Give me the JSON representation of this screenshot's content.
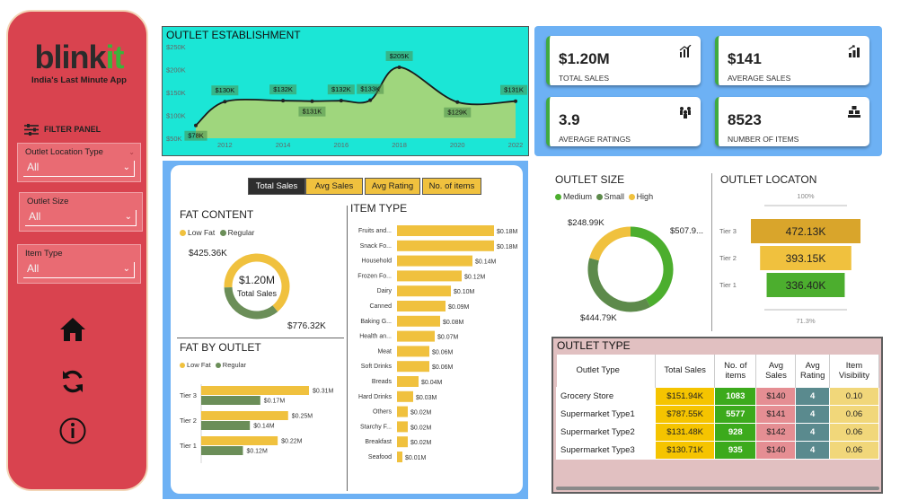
{
  "sidebar": {
    "logo_a": "blink",
    "logo_b": "it",
    "tagline": "India's Last Minute App",
    "filter_panel": "FILTER PANEL",
    "slicers": [
      {
        "label": "Outlet Location Type",
        "value": "All"
      },
      {
        "label": "Outlet Size",
        "value": "All"
      },
      {
        "label": "Item Type",
        "value": "All"
      }
    ],
    "icons": [
      "home-icon",
      "refresh-icon",
      "info-icon"
    ]
  },
  "establishment": {
    "title": "OUTLET ESTABLISHMENT",
    "chart_data": {
      "type": "area",
      "x": [
        2011,
        2012,
        2014,
        2015,
        2016,
        2017,
        2018,
        2020,
        2022
      ],
      "values": [
        78,
        130,
        132,
        131,
        132,
        133,
        205,
        129,
        131
      ],
      "labels": [
        "$78K",
        "$130K",
        "$132K",
        "$131K",
        "$132K",
        "$133K",
        "$205K",
        "$129K",
        "$131K"
      ],
      "x_ticks": [
        "2012",
        "2014",
        "2016",
        "2018",
        "2020",
        "2022"
      ],
      "y_ticks": [
        "$50K",
        "$100K",
        "$150K",
        "$200K",
        "$250K"
      ],
      "ylim": [
        50,
        250
      ],
      "color_fill": "#9fd67d",
      "color_line": "#1b1b1b"
    }
  },
  "kpis": [
    {
      "value": "$1.20M",
      "caption": "TOTAL SALES",
      "icon": "chart-up-icon"
    },
    {
      "value": "$141",
      "caption": "AVERAGE SALES",
      "icon": "bar-up-icon"
    },
    {
      "value": "3.9",
      "caption": "AVERAGE RATINGS",
      "icon": "rating-people-icon"
    },
    {
      "value": "8523",
      "caption": "NUMBER OF ITEMS",
      "icon": "items-boxes-icon"
    }
  ],
  "tabs": [
    "Total Sales",
    "Avg Sales",
    "Avg Rating",
    "No. of items"
  ],
  "fat_content": {
    "title": "FAT CONTENT",
    "legend": [
      "Low Fat",
      "Regular"
    ],
    "center_value": "$1.20M",
    "center_label": "Total Sales",
    "chart_data": {
      "type": "pie",
      "labels": [
        "Low Fat",
        "Regular"
      ],
      "values": [
        776.32,
        425.36
      ],
      "value_labels": [
        "$776.32K",
        "$425.36K"
      ],
      "colors": [
        "#f0c13e",
        "#6b8e58"
      ]
    }
  },
  "fat_by_outlet": {
    "title": "FAT BY OUTLET",
    "legend": [
      "Low Fat",
      "Regular"
    ],
    "chart_data": {
      "type": "bar",
      "categories": [
        "Tier 3",
        "Tier 2",
        "Tier 1"
      ],
      "series": [
        {
          "name": "Low Fat",
          "values": [
            0.31,
            0.25,
            0.22
          ],
          "labels": [
            "$0.31M",
            "$0.25M",
            "$0.22M"
          ]
        },
        {
          "name": "Regular",
          "values": [
            0.17,
            0.14,
            0.12
          ],
          "labels": [
            "$0.17M",
            "$0.14M",
            "$0.12M"
          ]
        }
      ],
      "colors": [
        "#f0c13e",
        "#6b8e58"
      ]
    }
  },
  "item_type": {
    "title": "ITEM TYPE",
    "chart_data": {
      "type": "bar",
      "categories": [
        "Fruits and...",
        "Snack Fo...",
        "Household",
        "Frozen Fo...",
        "Dairy",
        "Canned",
        "Baking G...",
        "Health an...",
        "Meat",
        "Soft Drinks",
        "Breads",
        "Hard Drinks",
        "Others",
        "Starchy F...",
        "Breakfast",
        "Seafood"
      ],
      "values": [
        0.18,
        0.18,
        0.14,
        0.12,
        0.1,
        0.09,
        0.08,
        0.07,
        0.06,
        0.06,
        0.04,
        0.03,
        0.02,
        0.02,
        0.02,
        0.01
      ],
      "labels": [
        "$0.18M",
        "$0.18M",
        "$0.14M",
        "$0.12M",
        "$0.10M",
        "$0.09M",
        "$0.08M",
        "$0.07M",
        "$0.06M",
        "$0.06M",
        "$0.04M",
        "$0.03M",
        "$0.02M",
        "$0.02M",
        "$0.02M",
        "$0.01M"
      ],
      "color": "#f0c13e"
    }
  },
  "outlet_size": {
    "title": "OUTLET SIZE",
    "legend": [
      "Medium",
      "Small",
      "High"
    ],
    "chart_data": {
      "type": "pie",
      "labels": [
        "Medium",
        "Small",
        "High"
      ],
      "values": [
        507.9,
        444.79,
        248.99
      ],
      "value_labels": [
        "$507.9...",
        "$444.79K",
        "$248.99K"
      ],
      "colors": [
        "#4cae2e",
        "#5d8a4b",
        "#f0c13e"
      ]
    }
  },
  "outlet_location": {
    "title": "OUTLET LOCATON",
    "top_pct": "100%",
    "bottom_pct": "71.3%",
    "chart_data": {
      "type": "bar",
      "categories": [
        "Tier 3",
        "Tier 2",
        "Tier 1"
      ],
      "values": [
        472.13,
        393.15,
        336.4
      ],
      "labels": [
        "472.13K",
        "393.15K",
        "336.40K"
      ],
      "colors": [
        "#d9a52b",
        "#f0c13e",
        "#4cae2e"
      ]
    }
  },
  "outlet_type": {
    "title": "OUTLET TYPE",
    "headers": [
      "Outlet Type",
      "Total Sales",
      "No. of items",
      "Avg Sales",
      "Avg Rating",
      "Item Visibility"
    ],
    "rows": [
      [
        "Grocery Store",
        "$151.94K",
        "1083",
        "$140",
        "4",
        "0.10"
      ],
      [
        "Supermarket Type1",
        "$787.55K",
        "5577",
        "$141",
        "4",
        "0.06"
      ],
      [
        "Supermarket Type2",
        "$131.48K",
        "928",
        "$142",
        "4",
        "0.06"
      ],
      [
        "Supermarket Type3",
        "$130.71K",
        "935",
        "$140",
        "4",
        "0.06"
      ]
    ],
    "col_colors": [
      "#ffffff",
      "#f5c400",
      "#3caa1c",
      "#e58e93",
      "#5a8a8e",
      "#f1d77a"
    ]
  }
}
